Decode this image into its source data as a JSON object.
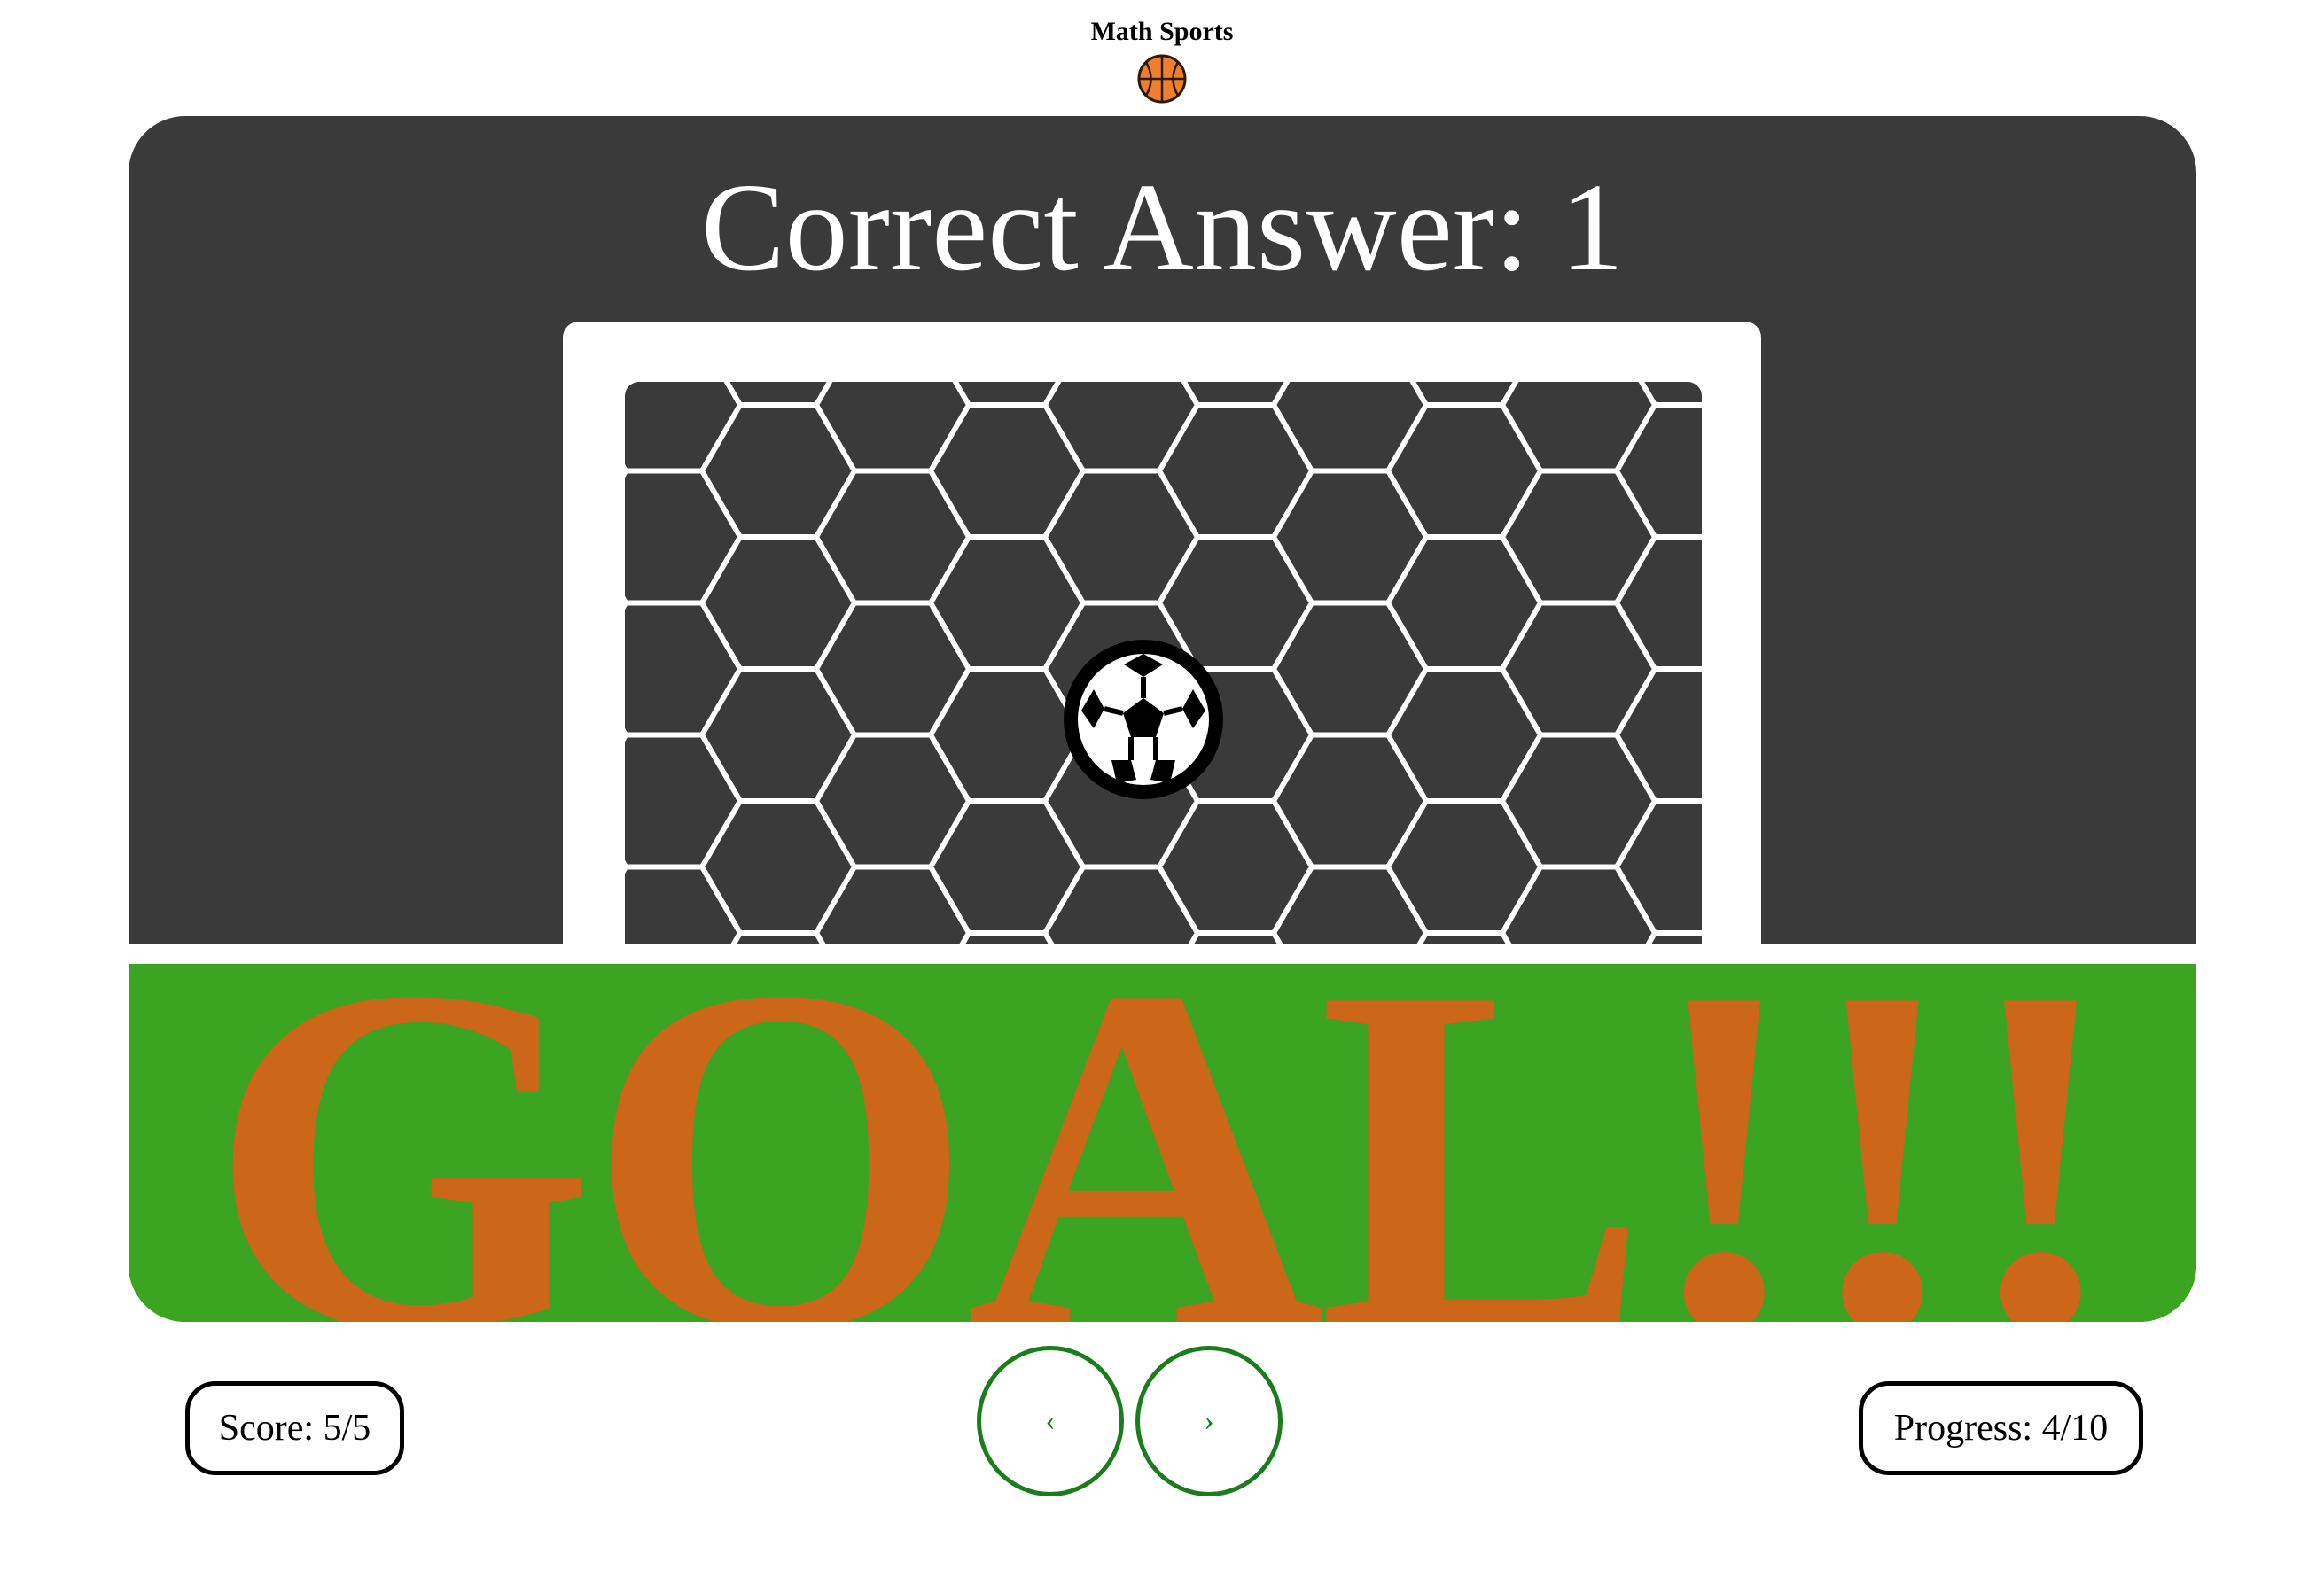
{
  "header": {
    "title": "Math Sports",
    "logo_icon": "basketball-icon"
  },
  "game": {
    "answer_heading": "Correct Answer: 1",
    "result_text": "GOAL!!!",
    "ball_icon": "soccer-ball-icon",
    "colors": {
      "card_background": "#3a3a3a",
      "pitch_green": "#3ba420",
      "result_orange": "#cc6619",
      "nav_green": "#1b7c1b",
      "basketball_orange": "#ee7f2d"
    }
  },
  "footer": {
    "score_label": "Score: 5/5",
    "progress_label": "Progress: 4/10",
    "prev_glyph": "‹",
    "next_glyph": "›"
  }
}
